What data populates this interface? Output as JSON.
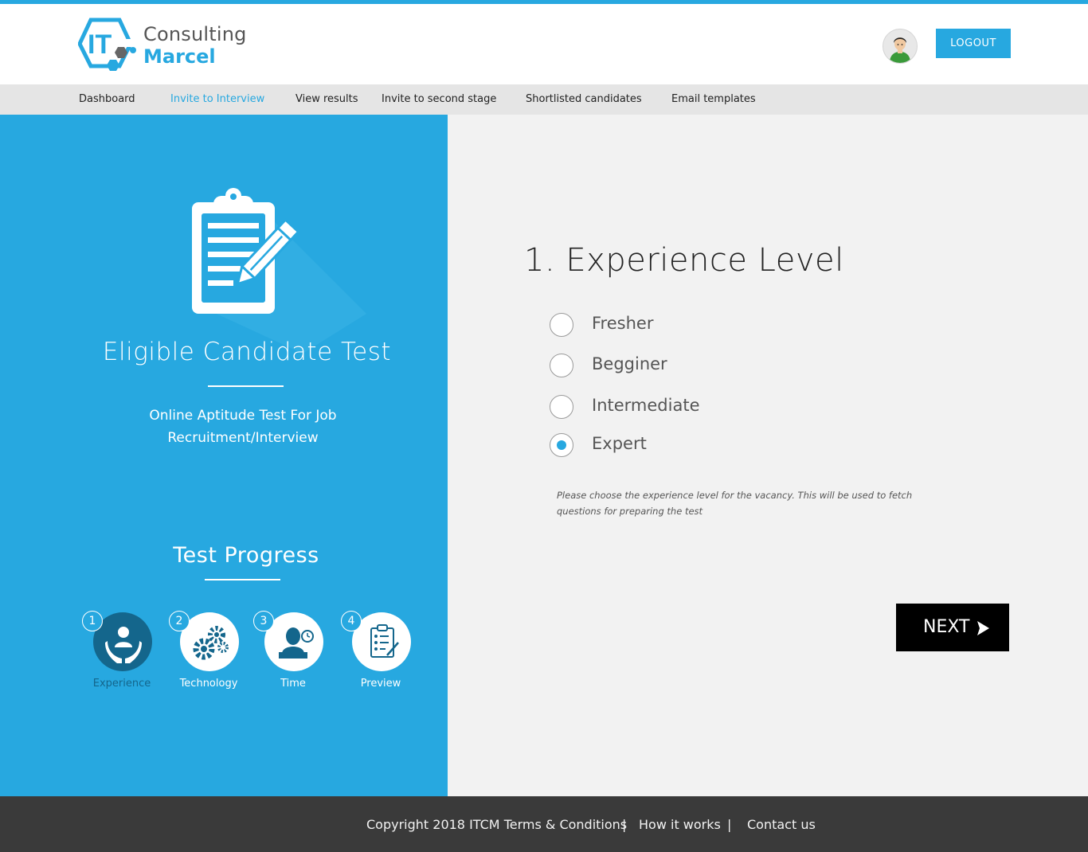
{
  "brand": {
    "line1": "Consulting",
    "line2": "Marcel",
    "mark": "IT",
    "accent": "#27a8e0"
  },
  "header": {
    "logout_label": "LOGOUT",
    "avatar_icon": "user-avatar-icon"
  },
  "nav": {
    "items": [
      {
        "label": "Dashboard"
      },
      {
        "label": "Invite to Interview",
        "active": true
      },
      {
        "label": "View results"
      },
      {
        "label": "Invite to second stage"
      },
      {
        "label": "Shortlisted candidates"
      },
      {
        "label": "Email templates"
      }
    ]
  },
  "hero": {
    "icon": "clipboard-pencil-icon",
    "title": "Eligible Candidate Test",
    "subtitle": "Online Aptitude Test For Job Recruitment/Interview"
  },
  "progress": {
    "title": "Test Progress",
    "steps": [
      {
        "num": "1",
        "label": "Experience",
        "icon": "hands-person-icon",
        "state": "current"
      },
      {
        "num": "2",
        "label": "Technology",
        "icon": "gears-icon"
      },
      {
        "num": "3",
        "label": "Time",
        "icon": "person-clock-icon"
      },
      {
        "num": "4",
        "label": "Preview",
        "icon": "checklist-icon"
      }
    ]
  },
  "question": {
    "title": "1. Experience Level",
    "options": [
      {
        "label": "Fresher",
        "selected": false
      },
      {
        "label": "Begginer",
        "selected": false
      },
      {
        "label": "Intermediate",
        "selected": false
      },
      {
        "label": "Expert",
        "selected": true
      }
    ],
    "hint": "Please choose the experience level for the vacancy. This will be used to fetch questions for preparing the test",
    "next_label": "NEXT"
  },
  "footer": {
    "copyright": "Copyright 2018 ITCM Terms & Conditions",
    "sep": "|",
    "how": "How it works",
    "contact": "Contact us"
  }
}
